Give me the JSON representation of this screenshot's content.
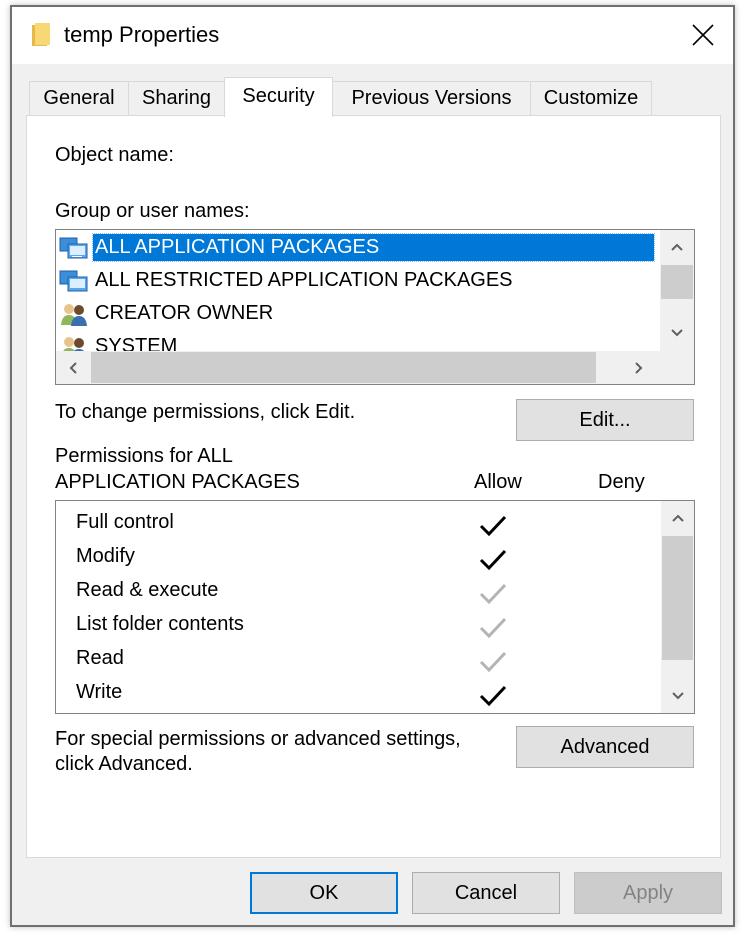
{
  "window": {
    "title": "temp Properties",
    "icon": "folder-icon",
    "close_icon": "close-icon"
  },
  "tabs": [
    {
      "label": "General",
      "active": false
    },
    {
      "label": "Sharing",
      "active": false
    },
    {
      "label": "Security",
      "active": true
    },
    {
      "label": "Previous Versions",
      "active": false
    },
    {
      "label": "Customize",
      "active": false
    }
  ],
  "security": {
    "object_name_label": "Object name:",
    "object_name_value": "",
    "group_label": "Group or user names:",
    "groups": [
      {
        "name": "ALL APPLICATION PACKAGES",
        "icon": "app-packages-icon",
        "selected": true
      },
      {
        "name": "ALL RESTRICTED APPLICATION PACKAGES",
        "icon": "app-packages-icon",
        "selected": false
      },
      {
        "name": "CREATOR OWNER",
        "icon": "users-group-icon",
        "selected": false
      },
      {
        "name": "SYSTEM",
        "icon": "users-group-icon",
        "selected": false
      }
    ],
    "change_hint": "To change permissions, click Edit.",
    "edit_button": "Edit...",
    "permissions_for_line1": "Permissions for ALL",
    "permissions_for_line2": "APPLICATION PACKAGES",
    "allow_header": "Allow",
    "deny_header": "Deny",
    "permissions": [
      {
        "name": "Full control",
        "allow": "checked",
        "deny": "none"
      },
      {
        "name": "Modify",
        "allow": "checked",
        "deny": "none"
      },
      {
        "name": "Read & execute",
        "allow": "inherited",
        "deny": "none"
      },
      {
        "name": "List folder contents",
        "allow": "inherited",
        "deny": "none"
      },
      {
        "name": "Read",
        "allow": "inherited",
        "deny": "none"
      },
      {
        "name": "Write",
        "allow": "checked",
        "deny": "none"
      }
    ],
    "advanced_hint_line1": "For special permissions or advanced settings,",
    "advanced_hint_line2": "click Advanced.",
    "advanced_button": "Advanced"
  },
  "footer": {
    "ok": "OK",
    "cancel": "Cancel",
    "apply": "Apply",
    "apply_enabled": false
  },
  "colors": {
    "selection": "#0078d7",
    "check_active": "#000000",
    "check_inherited": "#b4b4b4"
  }
}
